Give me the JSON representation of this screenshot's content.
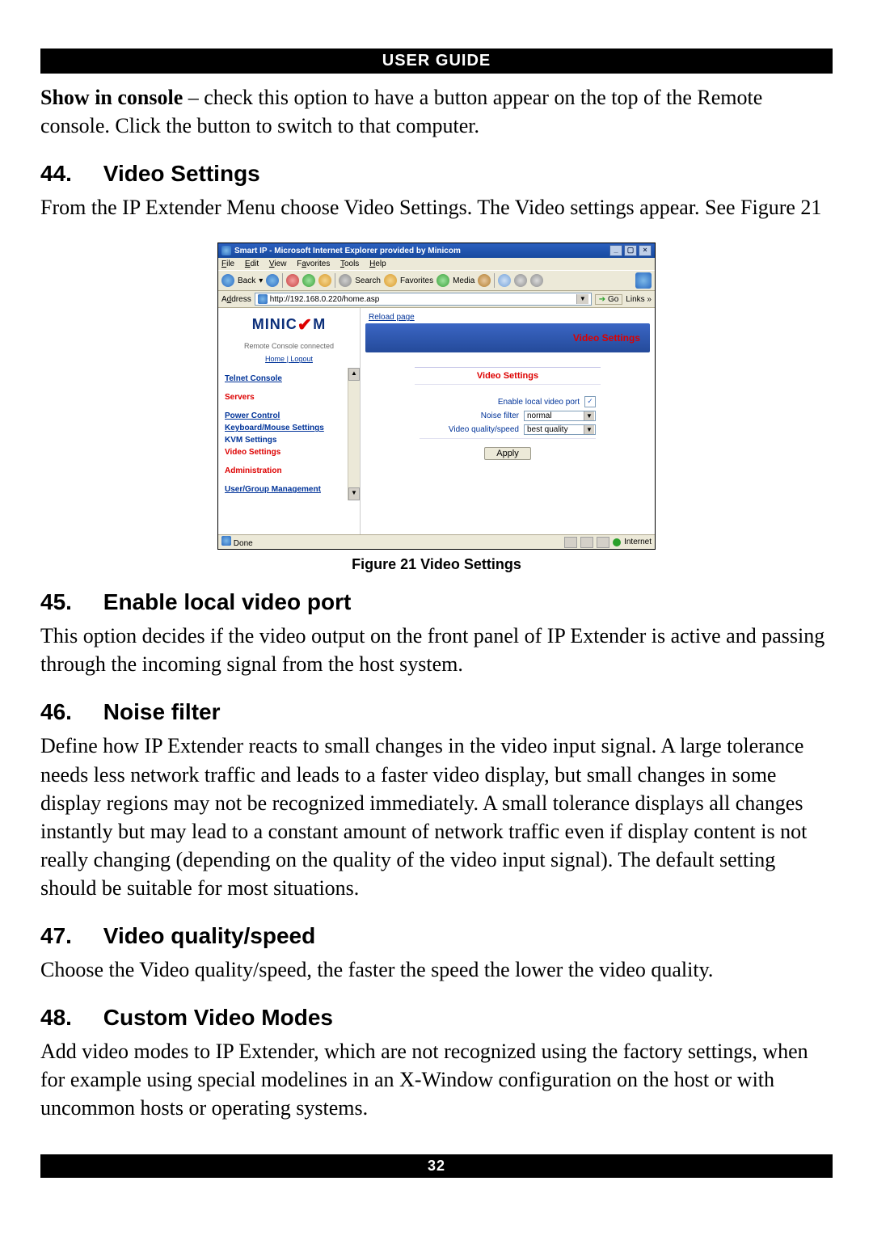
{
  "header": {
    "title": "USER GUIDE"
  },
  "footer": {
    "page": "32"
  },
  "intro": {
    "lead_bold": "Show in console",
    "lead_rest": " – check this option to have a button appear on the top of the Remote console. Click the button to switch to that computer."
  },
  "sections": [
    {
      "num": "44.",
      "title": "Video Settings",
      "body": "From the IP Extender Menu choose Video Settings. The Video settings appear. See Figure 21"
    },
    {
      "num": "45.",
      "title": "Enable local video port",
      "body": "This option decides if the video output on the front panel of IP Extender is active and passing through the incoming signal from the host system."
    },
    {
      "num": "46.",
      "title": "Noise filter",
      "body": "Define how IP Extender reacts to small changes in the video input signal. A large tolerance needs less network traffic and leads to a faster video display, but small changes in some display regions may not be recognized immediately. A small tolerance displays all changes instantly but may lead to a constant amount of network traffic even if display content is not really changing (depending on the quality of the video input signal). The default setting should be suitable for most situations."
    },
    {
      "num": "47.",
      "title": "Video quality/speed",
      "body": "Choose the Video quality/speed, the faster the speed the lower the video quality."
    },
    {
      "num": "48.",
      "title": "Custom Video Modes",
      "body": "Add video modes to IP Extender, which are not recognized using the factory settings, when for example using special modelines in an X-Window configuration on the host or with uncommon hosts or operating systems."
    }
  ],
  "figure": {
    "caption": "Figure 21 Video Settings",
    "ie": {
      "title": "Smart IP - Microsoft Internet Explorer provided by Minicom",
      "menu": {
        "file": "File",
        "edit": "Edit",
        "view": "View",
        "favorites": "Favorites",
        "tools": "Tools",
        "help": "Help"
      },
      "toolbar": {
        "back": "Back",
        "search": "Search",
        "favorites": "Favorites",
        "media": "Media"
      },
      "address_label": "Address",
      "url": "http://192.168.0.220/home.asp",
      "go": "Go",
      "links": "Links",
      "status_left": "Done",
      "status_right": "Internet"
    },
    "sidebar": {
      "logo_a": "MINIC",
      "logo_b": "M",
      "status": "Remote Console connected",
      "home": "Home",
      "logout": "Logout",
      "items": [
        {
          "label": "Telnet Console",
          "kind": "link"
        },
        {
          "label": "Servers",
          "kind": "current"
        },
        {
          "label": "Power Control",
          "kind": "link"
        },
        {
          "label": "Keyboard/Mouse Settings",
          "kind": "link"
        },
        {
          "label": "KVM Settings",
          "kind": "plain"
        },
        {
          "label": "Video Settings",
          "kind": "red"
        },
        {
          "label": "Administration",
          "kind": "current"
        },
        {
          "label": "User/Group Management",
          "kind": "link"
        }
      ]
    },
    "main": {
      "reload": "Reload page",
      "banner_title": "Video Settings",
      "panel_title": "Video Settings",
      "row1_label": "Enable local video port",
      "row1_checked": "✓",
      "row2_label": "Noise filter",
      "row2_value": "normal",
      "row3_label": "Video quality/speed",
      "row3_value": "best quality",
      "apply": "Apply"
    }
  }
}
